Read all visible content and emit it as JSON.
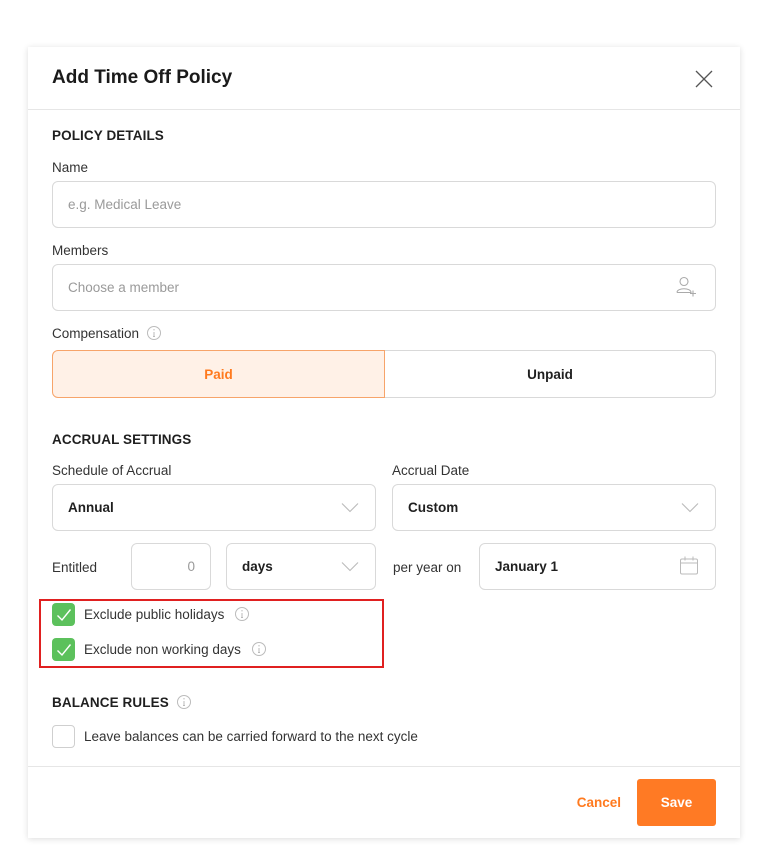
{
  "modal": {
    "title": "Add Time Off Policy"
  },
  "policy_details": {
    "section_title": "POLICY DETAILS",
    "name_label": "Name",
    "name_placeholder": "e.g. Medical Leave",
    "name_value": "",
    "members_label": "Members",
    "members_placeholder": "Choose a member",
    "compensation_label": "Compensation",
    "compensation_options": [
      "Paid",
      "Unpaid"
    ],
    "compensation_selected": "Paid"
  },
  "accrual_settings": {
    "section_title": "ACCRUAL SETTINGS",
    "schedule_label": "Schedule of Accrual",
    "schedule_value": "Annual",
    "accrual_date_label": "Accrual Date",
    "accrual_date_value": "Custom",
    "entitled_label": "Entitled",
    "entitled_value": "0",
    "unit_value": "days",
    "per_year_label": "per year on",
    "date_value": "January 1",
    "exclude_public_holidays": {
      "label": "Exclude public holidays",
      "checked": true
    },
    "exclude_non_working_days": {
      "label": "Exclude non working days",
      "checked": true
    }
  },
  "balance_rules": {
    "section_title": "BALANCE RULES",
    "carry_forward": {
      "label": "Leave balances can be carried forward to the next cycle",
      "checked": false
    }
  },
  "footer": {
    "cancel_label": "Cancel",
    "save_label": "Save"
  },
  "colors": {
    "accent": "#ff7a24",
    "accent_light": "#fff1e7",
    "check_green": "#5cc15c",
    "highlight_red": "#e02020"
  }
}
